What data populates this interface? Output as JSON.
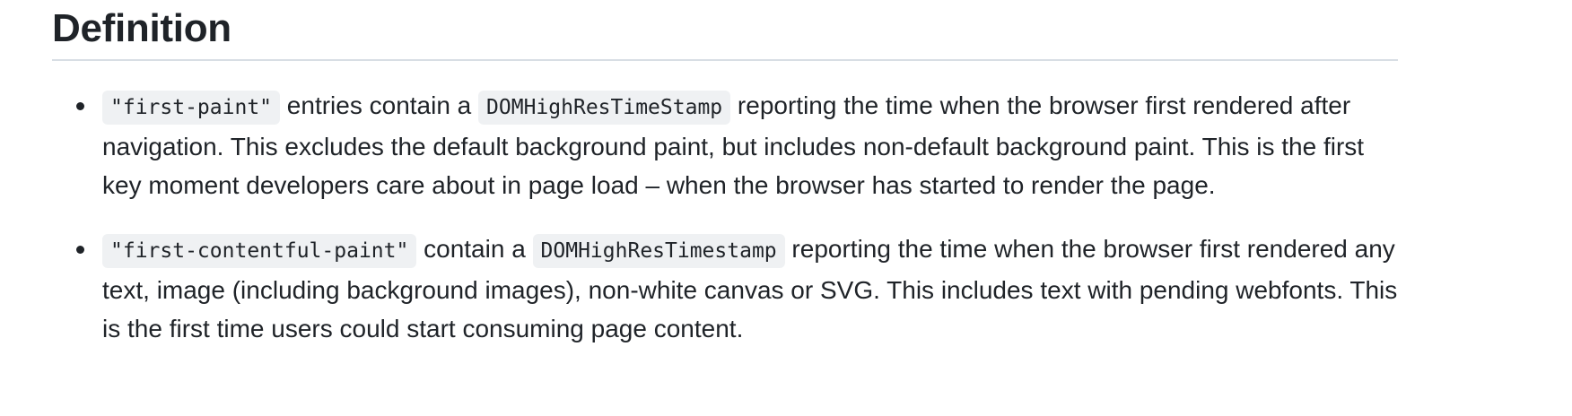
{
  "heading": "Definition",
  "items": [
    {
      "code1": "\"first-paint\"",
      "text1": " entries contain a ",
      "code2": "DOMHighResTimeStamp",
      "text2": " reporting the time when the browser first rendered after navigation. This excludes the default background paint, but includes non-default background paint. This is the first key moment developers care about in page load – when the browser has started to render the page."
    },
    {
      "code1": "\"first-contentful-paint\"",
      "text1": " contain a ",
      "code2": "DOMHighResTimestamp",
      "text2": " reporting the time when the browser first rendered any text, image (including background images), non-white canvas or SVG. This includes text with pending webfonts. This is the first time users could start consuming page content."
    }
  ]
}
